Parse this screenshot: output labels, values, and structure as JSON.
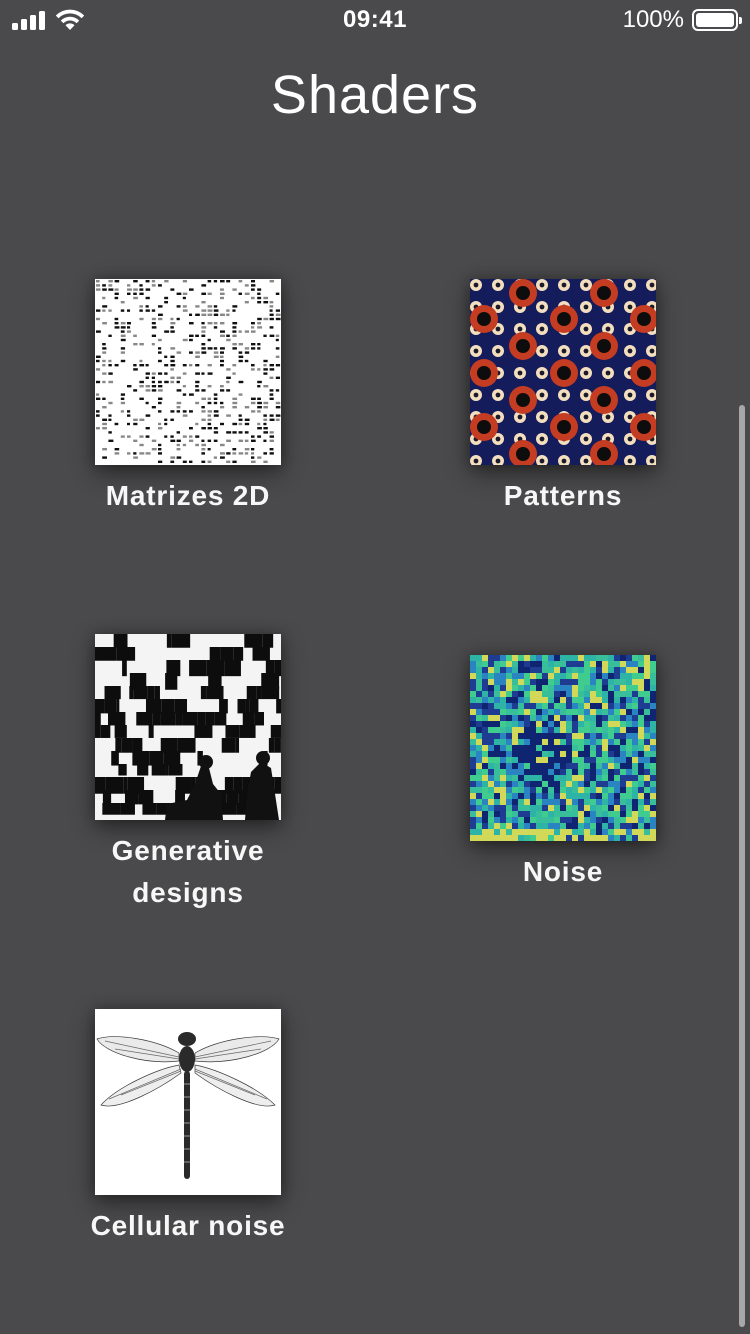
{
  "status_bar": {
    "time": "09:41",
    "battery_percent": "100%",
    "battery_level": 1.0,
    "signal_bars": 4,
    "wifi_icon": "wifi-icon"
  },
  "page": {
    "title": "Shaders",
    "background": "#4a4a4c"
  },
  "items": [
    {
      "label": "Matrizes 2D",
      "thumbnail": "matrix-rain-pattern"
    },
    {
      "label": "Patterns",
      "thumbnail": "red-dots-on-navy-pattern"
    },
    {
      "label": "Generative designs",
      "thumbnail": "black-white-bars-with-silhouettes"
    },
    {
      "label": "Noise",
      "thumbnail": "blue-green-noise-field"
    },
    {
      "label": "Cellular noise",
      "thumbnail": "dragonfly-illustration"
    }
  ],
  "colors": {
    "patterns_background": "#141c5c",
    "patterns_red": "#c43c22",
    "patterns_cream": "#f3dfbf",
    "noise_green": "#35c58e",
    "noise_navy": "#0a0f6a"
  }
}
